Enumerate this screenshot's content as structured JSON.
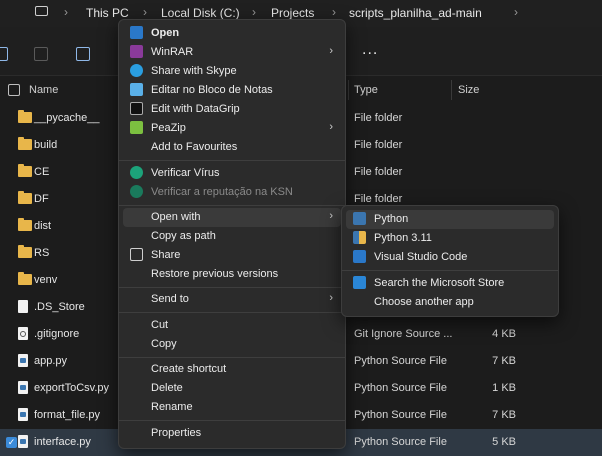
{
  "breadcrumb": [
    "This PC",
    "Local Disk (C:)",
    "Projects",
    "scripts_planilha_ad-main"
  ],
  "toolbar": {
    "more_label": "..."
  },
  "columns": {
    "name": "Name",
    "type": "Type",
    "size": "Size"
  },
  "files": [
    {
      "name": "__pycache__",
      "type": "File folder",
      "size": "",
      "kind": "folder"
    },
    {
      "name": "build",
      "type": "File folder",
      "size": "",
      "kind": "folder"
    },
    {
      "name": "CE",
      "type": "File folder",
      "size": "",
      "kind": "folder"
    },
    {
      "name": "DF",
      "type": "File folder",
      "size": "",
      "kind": "folder"
    },
    {
      "name": "dist",
      "type": "",
      "size": "",
      "kind": "folder"
    },
    {
      "name": "RS",
      "type": "",
      "size": "",
      "kind": "folder"
    },
    {
      "name": "venv",
      "type": "",
      "size": "",
      "kind": "folder"
    },
    {
      "name": ".DS_Store",
      "type": "",
      "size": "",
      "kind": "file"
    },
    {
      "name": ".gitignore",
      "type": "Git Ignore Source ...",
      "size": "4 KB",
      "kind": "gear"
    },
    {
      "name": "app.py",
      "type": "Python Source File",
      "size": "7 KB",
      "kind": "py"
    },
    {
      "name": "exportToCsv.py",
      "type": "Python Source File",
      "size": "1 KB",
      "kind": "py"
    },
    {
      "name": "format_file.py",
      "type": "Python Source File",
      "size": "7 KB",
      "kind": "py"
    },
    {
      "name": "interface.py",
      "type": "Python Source File",
      "size": "5 KB",
      "kind": "py",
      "selected": true
    }
  ],
  "context_menu": {
    "open": "Open",
    "winrar": "WinRAR",
    "share_skype": "Share with Skype",
    "notepad": "Editar no Bloco de Notas",
    "datagrip": "Edit with DataGrip",
    "peazip": "PeaZip",
    "favourites": "Add to Favourites",
    "verificar_virus": "Verificar Vírus",
    "verificar_ksn": "Verificar a reputação na KSN",
    "open_with": "Open with",
    "copy_path": "Copy as path",
    "share": "Share",
    "restore": "Restore previous versions",
    "send_to": "Send to",
    "cut": "Cut",
    "copy": "Copy",
    "create_shortcut": "Create shortcut",
    "delete": "Delete",
    "rename": "Rename",
    "properties": "Properties"
  },
  "submenu": {
    "python": "Python",
    "python311": "Python 3.11",
    "vscode": "Visual Studio Code",
    "store": "Search the Microsoft Store",
    "choose": "Choose another app"
  },
  "colors": {
    "accent": "#3b8bd9",
    "folder": "#e8b64a",
    "background": "#1c1c1c",
    "menu": "#2b2b2b"
  }
}
